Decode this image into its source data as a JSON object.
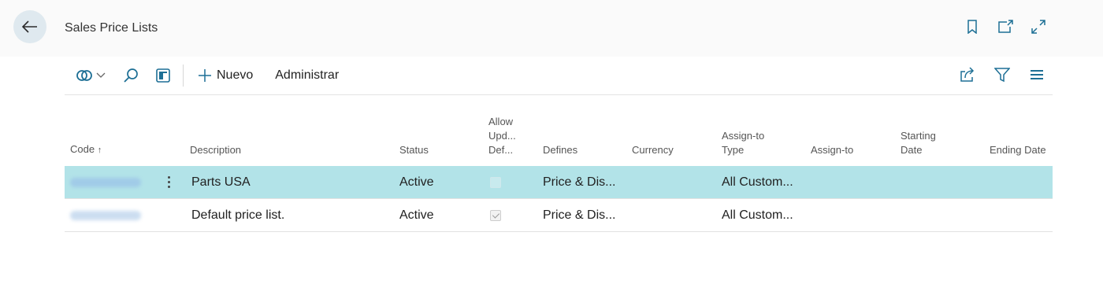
{
  "header": {
    "title": "Sales Price Lists",
    "icons": [
      "back-arrow-icon",
      "bookmark-icon",
      "open-new-window-icon",
      "expand-icon"
    ]
  },
  "toolbar": {
    "new_label": "Nuevo",
    "manage_label": "Administrar",
    "icons": [
      "copilot-icon",
      "chevron-down-icon",
      "search-icon",
      "list-view-icon",
      "plus-icon",
      "share-icon",
      "filter-icon",
      "columns-icon"
    ]
  },
  "table": {
    "columns": {
      "code": "Code",
      "description": "Description",
      "status": "Status",
      "allow_upd_1": "Allow",
      "allow_upd_2": "Upd...",
      "allow_upd_3": "Def...",
      "defines": "Defines",
      "currency": "Currency",
      "assign_type_1": "Assign-to",
      "assign_type_2": "Type",
      "assign_to": "Assign-to",
      "starting_1": "Starting",
      "starting_2": "Date",
      "ending_date": "Ending Date"
    },
    "sort_indicator": "↑",
    "rows": [
      {
        "code": "",
        "description": "Parts USA",
        "status": "Active",
        "allow_update": false,
        "defines": "Price & Dis...",
        "currency": "",
        "assign_type": "All Custom...",
        "assign_to": "",
        "starting_date": "",
        "ending_date": ""
      },
      {
        "code": "",
        "description": "Default price list.",
        "status": "Active",
        "allow_update": true,
        "defines": "Price & Dis...",
        "currency": "",
        "assign_type": "All Custom...",
        "assign_to": "",
        "starting_date": "",
        "ending_date": ""
      }
    ]
  },
  "colors": {
    "selected_row": "#b2e3e8",
    "accent": "#1d6f95"
  }
}
